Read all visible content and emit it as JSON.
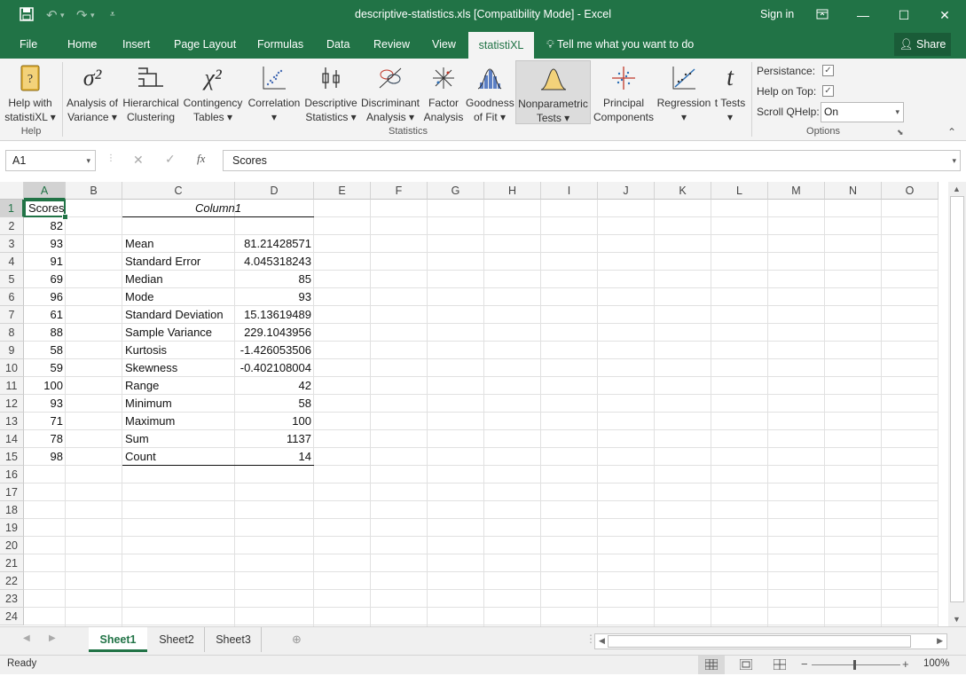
{
  "window": {
    "title": "descriptive-statistics.xls  [Compatibility Mode] - Excel",
    "signin": "Sign in"
  },
  "tabs": [
    "File",
    "Home",
    "Insert",
    "Page Layout",
    "Formulas",
    "Data",
    "Review",
    "View",
    "statistiXL"
  ],
  "tellme": "Tell me what you want to do",
  "share": "Share",
  "ribbon": {
    "help_line1": "Help with",
    "help_line2": "statistiXL",
    "buttons": [
      {
        "l1": "Analysis of",
        "l2": "Variance",
        "icon": "σ²"
      },
      {
        "l1": "Hierarchical",
        "l2": "Clustering",
        "icon": "⊏"
      },
      {
        "l1": "Contingency",
        "l2": "Tables",
        "icon": "χ²"
      },
      {
        "l1": "Correlation",
        "l2": "",
        "icon": "⋰"
      },
      {
        "l1": "Descriptive",
        "l2": "Statistics",
        "icon": "⌶"
      },
      {
        "l1": "Discriminant",
        "l2": "Analysis",
        "icon": "⊕"
      },
      {
        "l1": "Factor",
        "l2": "Analysis",
        "icon": "✳"
      },
      {
        "l1": "Goodness",
        "l2": "of Fit",
        "icon": "◭"
      },
      {
        "l1": "Nonparametric",
        "l2": "Tests",
        "icon": "△"
      },
      {
        "l1": "Principal",
        "l2": "Components",
        "icon": "✛"
      },
      {
        "l1": "Regression",
        "l2": "",
        "icon": "⟋"
      },
      {
        "l1": "t Tests",
        "l2": "",
        "icon": "t"
      }
    ],
    "group_help": "Help",
    "group_statistics": "Statistics",
    "group_options": "Options",
    "persistance_label": "Persistance:",
    "helpontop_label": "Help on Top:",
    "scrollqhelp_label": "Scroll QHelp:",
    "scrollqhelp_value": "On",
    "check_mark": "✓"
  },
  "formula_bar": {
    "name_box": "A1",
    "fx": "fx",
    "value": "Scores"
  },
  "columns": [
    "A",
    "B",
    "C",
    "D",
    "E",
    "F",
    "G",
    "H",
    "I",
    "J",
    "K",
    "L",
    "M",
    "N",
    "O"
  ],
  "rows": [
    "1",
    "2",
    "3",
    "4",
    "5",
    "6",
    "7",
    "8",
    "9",
    "10",
    "11",
    "12",
    "13",
    "14",
    "15",
    "16",
    "17",
    "18",
    "19",
    "20",
    "21",
    "22",
    "23",
    "24"
  ],
  "cells": {
    "A1": "Scores",
    "colA": [
      "82",
      "93",
      "91",
      "69",
      "96",
      "61",
      "88",
      "58",
      "59",
      "100",
      "93",
      "71",
      "78",
      "98"
    ],
    "C1": "Column1",
    "stats": [
      {
        "label": "Mean",
        "value": "81.21428571"
      },
      {
        "label": "Standard Error",
        "value": "4.045318243"
      },
      {
        "label": "Median",
        "value": "85"
      },
      {
        "label": "Mode",
        "value": "93"
      },
      {
        "label": "Standard Deviation",
        "value": "15.13619489"
      },
      {
        "label": "Sample Variance",
        "value": "229.1043956"
      },
      {
        "label": "Kurtosis",
        "value": "-1.426053506"
      },
      {
        "label": "Skewness",
        "value": "-0.402108004"
      },
      {
        "label": "Range",
        "value": "42"
      },
      {
        "label": "Minimum",
        "value": "58"
      },
      {
        "label": "Maximum",
        "value": "100"
      },
      {
        "label": "Sum",
        "value": "1137"
      },
      {
        "label": "Count",
        "value": "14"
      }
    ]
  },
  "sheets": [
    "Sheet1",
    "Sheet2",
    "Sheet3"
  ],
  "status": {
    "ready": "Ready",
    "zoom": "100%"
  },
  "colors": {
    "accent": "#217346"
  }
}
